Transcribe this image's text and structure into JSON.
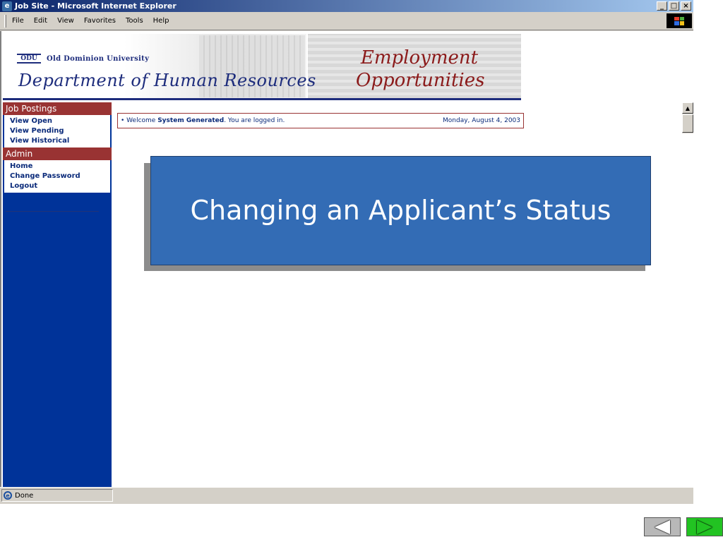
{
  "window": {
    "title": "Job Site - Microsoft Internet Explorer",
    "icon": "ie-icon",
    "buttons": {
      "minimize": "_",
      "maximize": "□",
      "close": "×"
    }
  },
  "menubar": {
    "items": [
      "File",
      "Edit",
      "View",
      "Favorites",
      "Tools",
      "Help"
    ]
  },
  "banner": {
    "university": "Old Dominion University",
    "logo_text": "ODU",
    "department": "Department of Human Resources",
    "heading_line1": "Employment",
    "heading_line2": "Opportunities"
  },
  "sidebar": {
    "sections": [
      {
        "heading": "Job Postings",
        "links": [
          "View Open",
          "View Pending",
          "View Historical"
        ]
      },
      {
        "heading": "Admin",
        "links": [
          "Home",
          "Change Password",
          "Logout"
        ]
      }
    ]
  },
  "welcome": {
    "prefix": "• Welcome ",
    "user": "System Generated",
    "suffix": ". You are logged in.",
    "date": "Monday, August 4, 2003"
  },
  "statusbar": {
    "text": "Done"
  },
  "slide": {
    "title": "Changing an Applicant’s Status"
  },
  "colors": {
    "sidebar_bg": "#003399",
    "section_header": "#993333",
    "title_box": "#336cb5",
    "next_button": "#22c322"
  }
}
